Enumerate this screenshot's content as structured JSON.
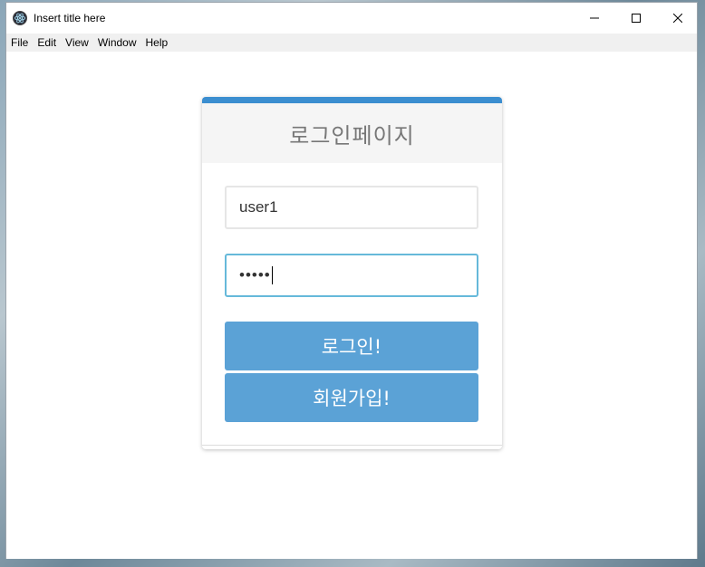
{
  "window": {
    "title": "Insert title here",
    "app_icon": "atom-icon",
    "controls": [
      "minimize-icon",
      "maximize-icon",
      "close-icon"
    ]
  },
  "menubar": {
    "items": [
      {
        "label": "File"
      },
      {
        "label": "Edit"
      },
      {
        "label": "View"
      },
      {
        "label": "Window"
      },
      {
        "label": "Help"
      }
    ]
  },
  "login": {
    "heading": "로그인페이지",
    "username": {
      "value": "user1"
    },
    "password": {
      "masked_value": "•••••"
    },
    "login_button": "로그인!",
    "join_button": "회원가입!"
  },
  "colors": {
    "accent": "#3b8ed0",
    "button": "#5ba2d6",
    "focus_border": "#66b9da"
  }
}
